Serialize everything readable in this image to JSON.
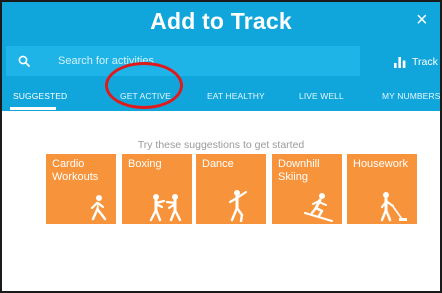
{
  "window": {
    "title": "Add to Track",
    "close_glyph": "×"
  },
  "search": {
    "placeholder": "Search for activities",
    "value": ""
  },
  "track_button": {
    "label": "Track"
  },
  "tabs": [
    {
      "label": "SUGGESTED",
      "active": true
    },
    {
      "label": "GET ACTIVE",
      "active": false
    },
    {
      "label": "EAT HEALTHY",
      "active": false
    },
    {
      "label": "LIVE WELL",
      "active": false
    },
    {
      "label": "MY NUMBERS",
      "active": false
    }
  ],
  "main": {
    "hint": "Try these suggestions to get started",
    "tiles": [
      {
        "label": "Cardio Workouts",
        "icon": "walking-person-icon"
      },
      {
        "label": "Boxing",
        "icon": "boxing-icon"
      },
      {
        "label": "Dance",
        "icon": "dancer-icon"
      },
      {
        "label": "Downhill Skiing",
        "icon": "skier-icon"
      },
      {
        "label": "Housework",
        "icon": "vacuum-person-icon"
      }
    ]
  },
  "colors": {
    "header_blue": "#10a6dc",
    "search_field": "#1eb4e7",
    "tile_orange": "#f7943b",
    "annotation_red": "#e01a1a",
    "hint_gray": "#9a9a9a"
  }
}
